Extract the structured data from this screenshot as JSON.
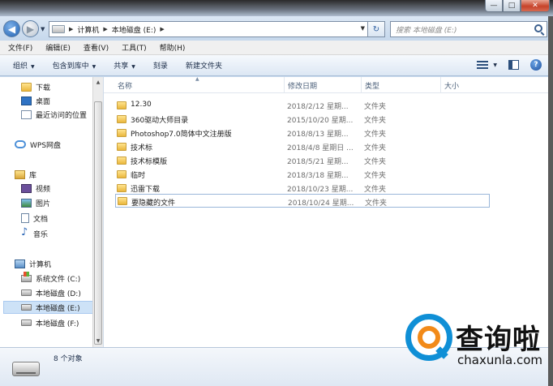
{
  "window": {
    "buttons": {
      "minimize": "—",
      "maximize": "□",
      "close": "✕"
    }
  },
  "address": {
    "crumbs": [
      "计算机",
      "本地磁盘 (E:)"
    ],
    "search_placeholder": "搜索 本地磁盘 (E:)"
  },
  "menubar": {
    "items": [
      "文件(F)",
      "编辑(E)",
      "查看(V)",
      "工具(T)",
      "帮助(H)"
    ]
  },
  "toolbar": {
    "organize": "组织",
    "include_library": "包含到库中",
    "share": "共享",
    "burn": "刻录",
    "new_folder": "新建文件夹"
  },
  "navpane": {
    "favorites": [
      "下载",
      "桌面",
      "最近访问的位置"
    ],
    "wps": "WPS网盘",
    "libraries_label": "库",
    "libraries": [
      "视频",
      "图片",
      "文档",
      "音乐"
    ],
    "computer_label": "计算机",
    "drives": [
      "系统文件 (C:)",
      "本地磁盘 (D:)",
      "本地磁盘 (E:)",
      "本地磁盘 (F:)"
    ],
    "selected": "本地磁盘 (E:)"
  },
  "columns": {
    "name": "名称",
    "modified": "修改日期",
    "type": "类型",
    "size": "大小"
  },
  "files": [
    {
      "name": "12.30",
      "date": "2018/2/12 星期...",
      "type": "文件夹"
    },
    {
      "name": "360驱动大师目录",
      "date": "2015/10/20 星期...",
      "type": "文件夹"
    },
    {
      "name": "Photoshop7.0简体中文注册版",
      "date": "2018/8/13 星期...",
      "type": "文件夹"
    },
    {
      "name": "技术标",
      "date": "2018/4/8 星期日 ...",
      "type": "文件夹"
    },
    {
      "name": "技术标模版",
      "date": "2018/5/21 星期...",
      "type": "文件夹"
    },
    {
      "name": "临时",
      "date": "2018/3/18 星期...",
      "type": "文件夹"
    },
    {
      "name": "迅雷下载",
      "date": "2018/10/23 星期...",
      "type": "文件夹"
    },
    {
      "name": "要隐藏的文件",
      "date": "2018/10/24 星期...",
      "type": "文件夹"
    }
  ],
  "status": {
    "count": "8 个对象"
  },
  "watermark": {
    "brand": "查询啦",
    "url": "chaxunla.com"
  }
}
